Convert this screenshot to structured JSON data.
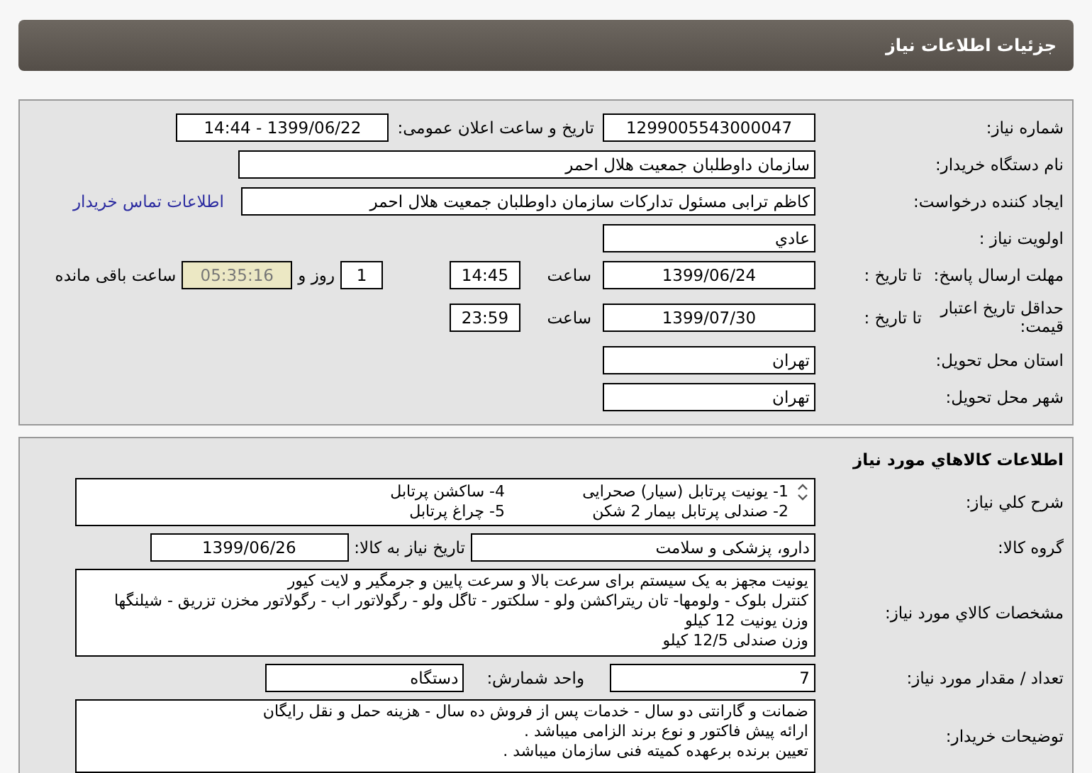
{
  "header": {
    "title": "جزئیات اطلاعات نیاز"
  },
  "need_info": {
    "need_number": {
      "label": "شماره نیاز:",
      "value": "1299005543000047"
    },
    "announce": {
      "label": "تاریخ و ساعت اعلان عمومی:",
      "value": "1399/06/22 - 14:44"
    },
    "buyer_org": {
      "label": "نام دستگاه خریدار:",
      "value": "سازمان داوطلبان جمعیت هلال احمر"
    },
    "requester": {
      "label": "ایجاد کننده درخواست:",
      "value": "کاظم ترابی مسئول تدارکات سازمان داوطلبان جمعیت هلال احمر",
      "link": "اطلاعات تماس خریدار"
    },
    "priority": {
      "label": "اولویت نیاز :",
      "value": "عادي"
    },
    "response_deadline": {
      "label": "مهلت ارسال پاسخ:",
      "to_date_label": "تا تاریخ :",
      "date": "1399/06/24",
      "time_label": "ساعت",
      "time": "14:45",
      "days": "1",
      "days_label": "روز و",
      "remaining": "05:35:16",
      "remaining_label": "ساعت باقی مانده"
    },
    "price_validity": {
      "label": "حداقل تاریخ اعتبار قیمت:",
      "to_date_label": "تا تاریخ :",
      "date": "1399/07/30",
      "time_label": "ساعت",
      "time": "23:59"
    },
    "province": {
      "label": "استان محل تحویل:",
      "value": "تهران"
    },
    "city": {
      "label": "شهر محل تحویل:",
      "value": "تهران"
    }
  },
  "goods": {
    "title": "اطلاعات کالاهاي مورد نیاز",
    "general_description": {
      "label": "شرح کلي نیاز:",
      "lines": [
        [
          "1- یونیت پرتابل (سیار) صحرایی",
          "4- ساکشن پرتابل"
        ],
        [
          "2- صندلی پرتابل بیمار 2 شکن",
          "5- چراغ پرتابل"
        ]
      ]
    },
    "goods_group": {
      "label": "گروه کالا:",
      "value": "دارو، پزشکی و سلامت"
    },
    "need_date": {
      "label": "تاریخ نیاز به کالا:",
      "value": "1399/06/26"
    },
    "specs": {
      "label": "مشخصات کالاي مورد نیاز:",
      "lines": [
        "یونیت مجهز به یک سیستم برای سرعت بالا و سرعت پایین و جرمگیر و لایت کیور",
        "کنترل بلوک - ولومها- تان ریتراکشن ولو - سلکتور - تاگل ولو - رگولاتور اب - رگولاتور مخزن تزریق - شیلنگها",
        "وزن یونیت 12 کیلو",
        "وزن صندلی 12/5 کیلو"
      ]
    },
    "quantity": {
      "label": "تعداد / مقدار مورد نیاز:",
      "value": "7"
    },
    "unit": {
      "label": "واحد شمارش:",
      "value": "دستگاه"
    },
    "buyer_notes": {
      "label": "توضیحات خریدار:",
      "lines": [
        "ضمانت و گارانتی دو سال - خدمات پس از فروش ده سال - هزینه حمل و نقل رایگان",
        "ارائه پیش فاکتور و نوع برند  الزامی میباشد .",
        "تعیین برنده برعهده کمیته فنی سازمان میباشد ."
      ]
    }
  }
}
